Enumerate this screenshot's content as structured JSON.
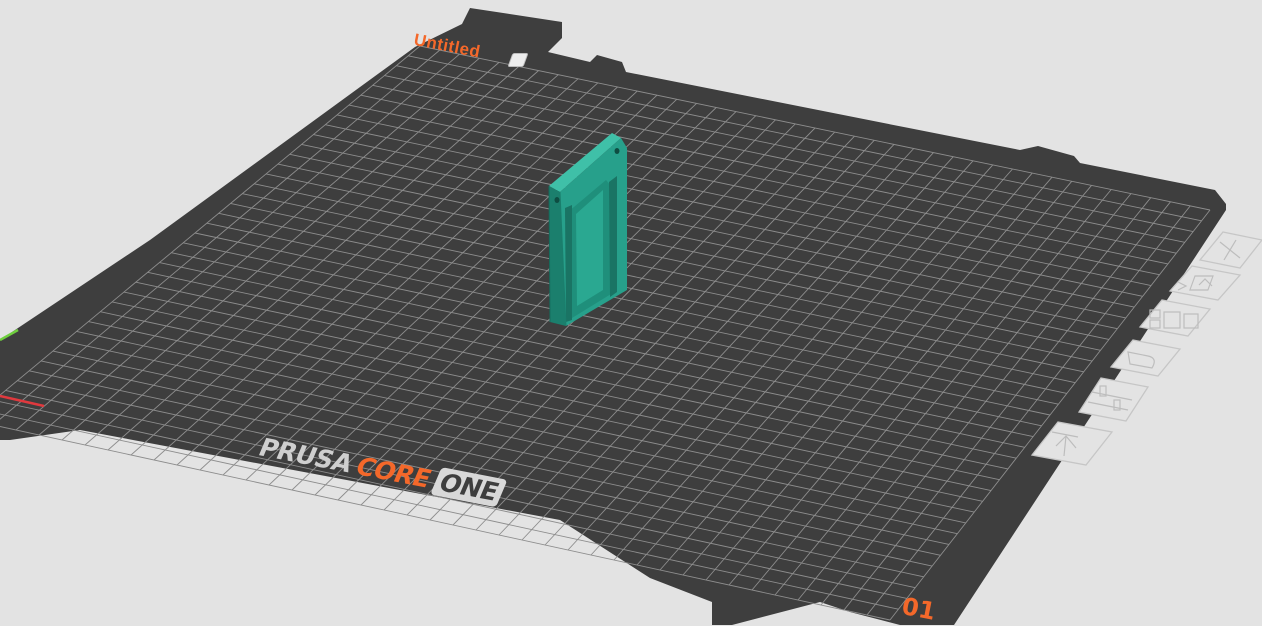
{
  "plate": {
    "name": "Untitled",
    "number": "01"
  },
  "printer": {
    "brand": "PRUSA",
    "model_line": "CORE",
    "model": "ONE"
  },
  "colors": {
    "background": "#e3e3e3",
    "bed": "#3e3e3e",
    "bed_grid": "#8d8d8d",
    "accent": "#f4682a",
    "model": "#27a08b"
  },
  "plate_tools": [
    {
      "name": "delete-plate",
      "icon": "close-icon"
    },
    {
      "name": "arrange-plate",
      "icon": "arrange-icon"
    },
    {
      "name": "orient-plate",
      "icon": "layout-icon"
    },
    {
      "name": "lock-plate",
      "icon": "lock-icon"
    },
    {
      "name": "plate-settings",
      "icon": "settings-icon"
    },
    {
      "name": "move-plate",
      "icon": "move-icon"
    }
  ]
}
